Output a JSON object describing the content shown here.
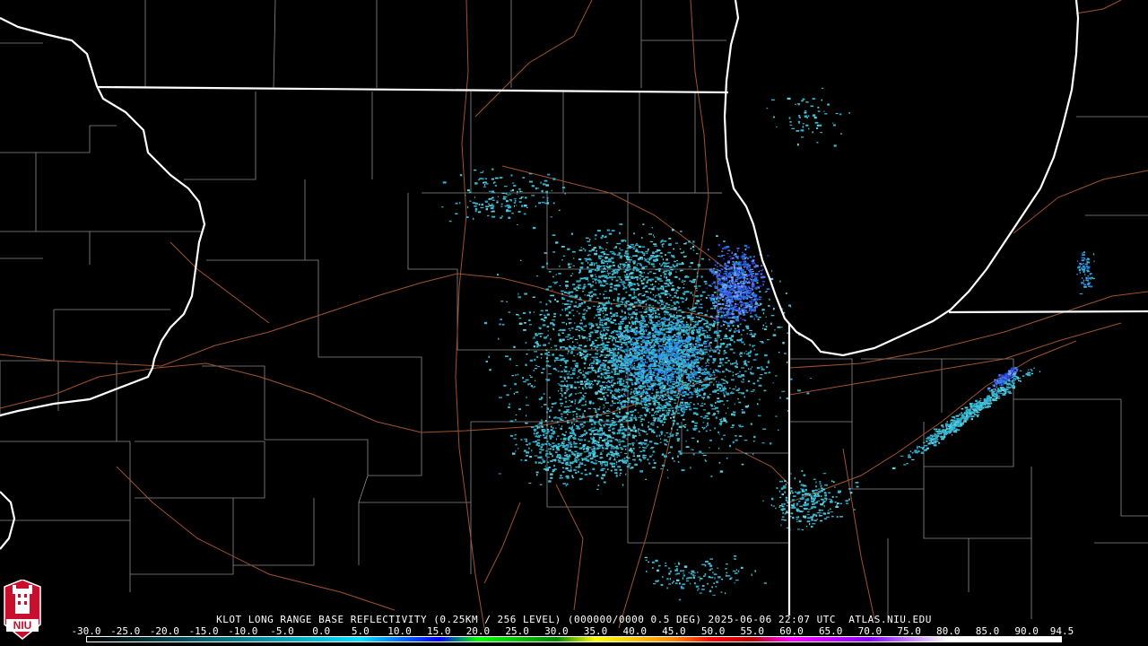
{
  "caption": "KLOT LONG RANGE BASE REFLECTIVITY (0.25KM / 256 LEVEL) (000000/0000 0.5 DEG) 2025-06-06 22:07 UTC  ATLAS.NIU.EDU",
  "logo_text": "NIU",
  "colorbar": {
    "ticks": [
      "-30.0",
      "-25.0",
      "-20.0",
      "-15.0",
      "-10.0",
      "-5.0",
      "0.0",
      "5.0",
      "10.0",
      "15.0",
      "20.0",
      "25.0",
      "30.0",
      "35.0",
      "40.0",
      "45.0",
      "50.0",
      "55.0",
      "60.0",
      "65.0",
      "70.0",
      "75.0",
      "80.0",
      "85.0",
      "90.0",
      "94.5"
    ],
    "stops": [
      {
        "value": -30,
        "color": "#000000"
      },
      {
        "value": 5,
        "color": "#00e0ff"
      },
      {
        "value": 15,
        "color": "#0000ff"
      },
      {
        "value": 20,
        "color": "#00ff00"
      },
      {
        "value": 30,
        "color": "#008800"
      },
      {
        "value": 35,
        "color": "#ffff00"
      },
      {
        "value": 45,
        "color": "#ff8800"
      },
      {
        "value": 50,
        "color": "#ff0000"
      },
      {
        "value": 55,
        "color": "#c00000"
      },
      {
        "value": 60,
        "color": "#ff00ff"
      },
      {
        "value": 70,
        "color": "#8800ff"
      },
      {
        "value": 80,
        "color": "#ffffff"
      },
      {
        "value": 94.5,
        "color": "#ffffff"
      }
    ]
  },
  "colors": {
    "state_border": "#ffffff",
    "county_border": "#8a8a8a",
    "highway": "#a0522d",
    "echo_light": "#3ab8d0",
    "echo_mid": "#1f7fe0",
    "echo_strong": "#2a40d8"
  }
}
